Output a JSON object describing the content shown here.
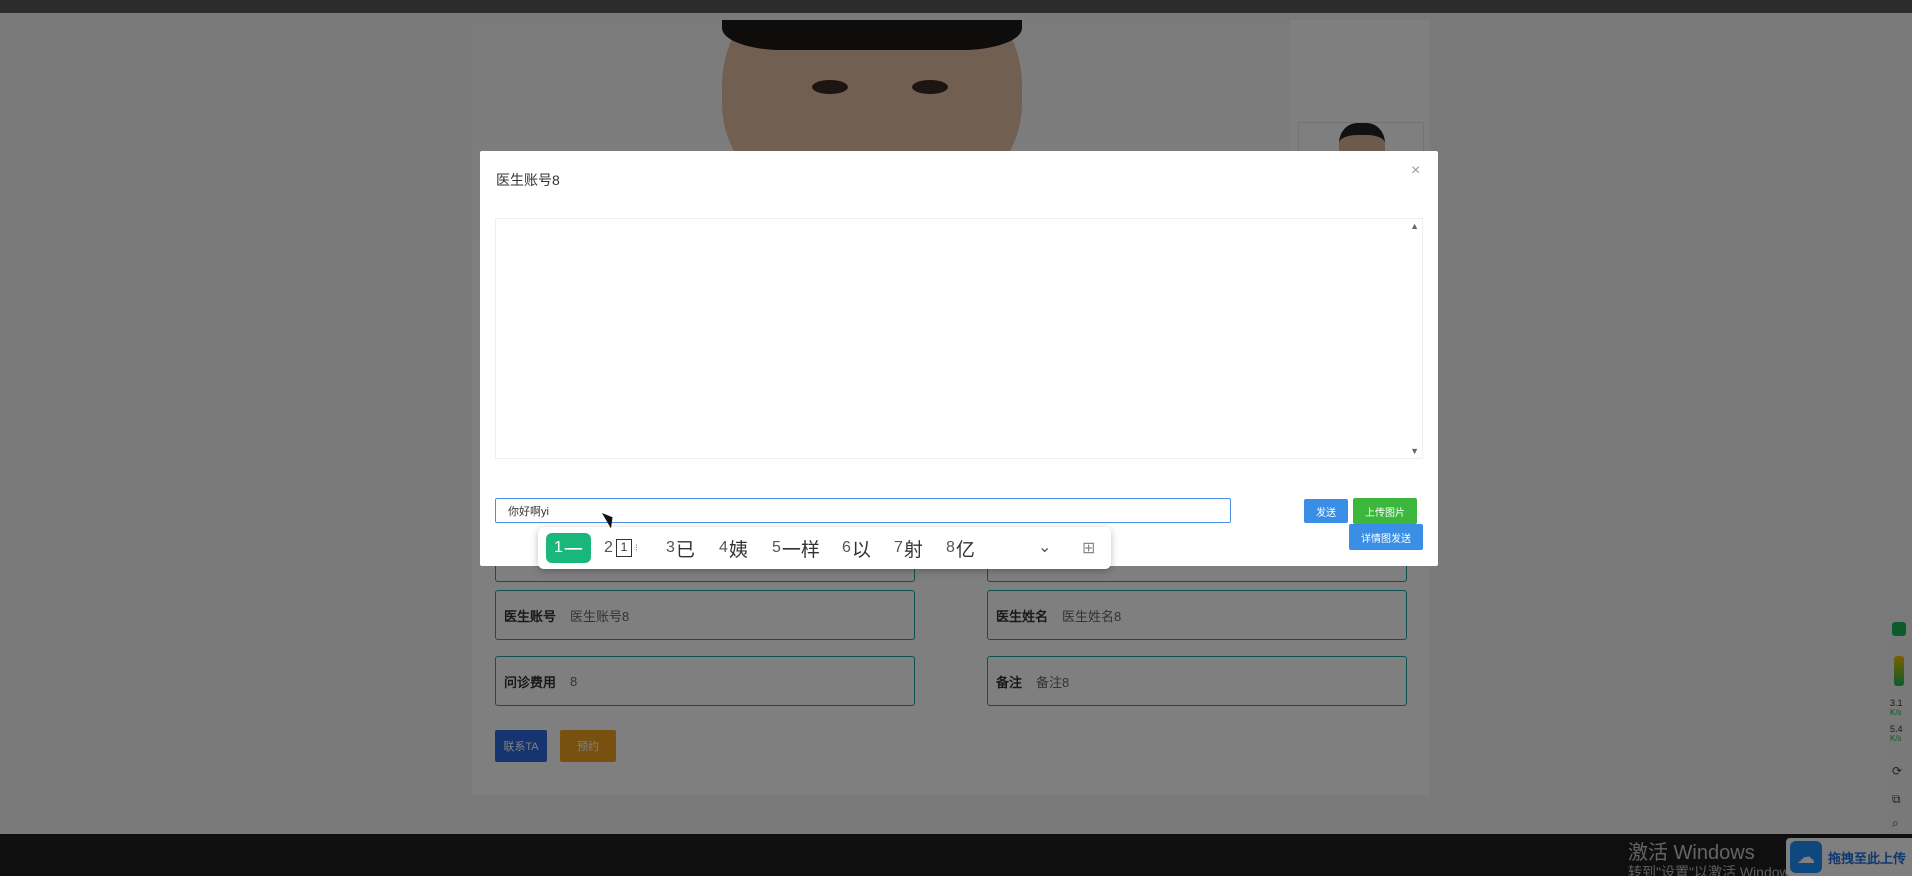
{
  "background": {
    "fields": [
      {
        "label": "医生账号",
        "value": "医生账号8"
      },
      {
        "label": "医生姓名",
        "value": "医生姓名8"
      },
      {
        "label": "问诊费用",
        "value": "8"
      },
      {
        "label": "备注",
        "value": "备注8"
      }
    ],
    "contact_button": "联系TA",
    "reserve_button": "预约"
  },
  "modal": {
    "title": "医生账号8",
    "close_label": "×",
    "input_value": "你好啊yi",
    "send_button": "发送",
    "upload_button": "上传图片",
    "detail_button": "详情图发送"
  },
  "ime": {
    "candidates": [
      {
        "num": "1",
        "text": "一"
      },
      {
        "num": "2",
        "text": "1"
      },
      {
        "num": "3",
        "text": "已"
      },
      {
        "num": "4",
        "text": "姨"
      },
      {
        "num": "5",
        "text": "一样"
      },
      {
        "num": "6",
        "text": "以"
      },
      {
        "num": "7",
        "text": "射"
      },
      {
        "num": "8",
        "text": "亿"
      }
    ]
  },
  "system": {
    "activate_title": "激活 Windows",
    "activate_sub": "转到\"设置\"以激活 Windows。",
    "upload_float_text": "拖拽至此上传",
    "speed_up": "3.1",
    "speed_down": "5.4",
    "speed_unit": "K/s"
  },
  "colors": {
    "field_border": "#1aa3a3",
    "send_blue": "#3a8ee6",
    "upload_green": "#3bb83b",
    "ime_active": "#19b77a",
    "contact_blue": "#2d6ae0",
    "reserve_orange": "#f0a020"
  }
}
